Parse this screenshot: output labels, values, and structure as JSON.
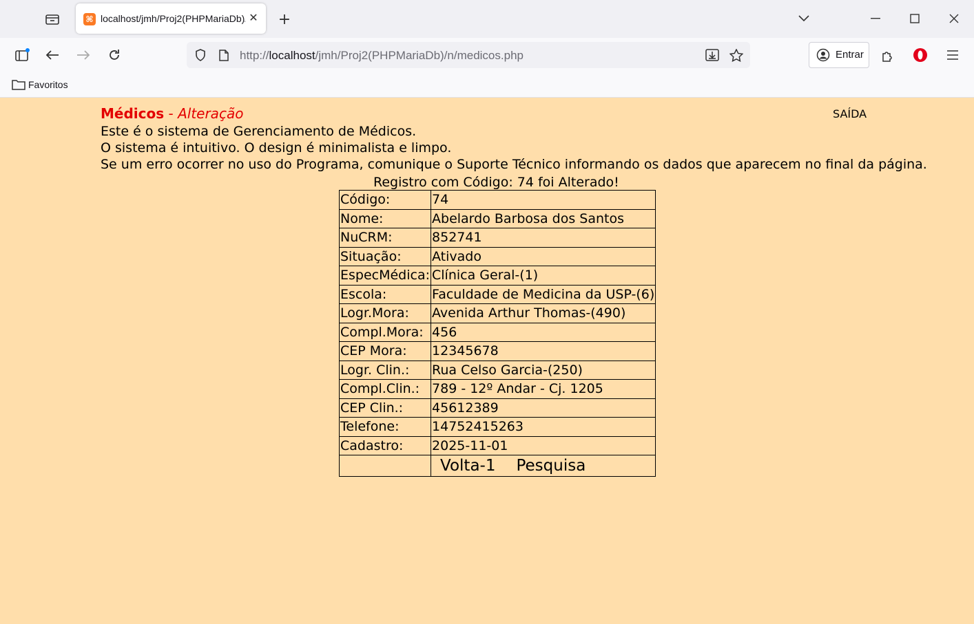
{
  "browser": {
    "tab_title": "localhost/jmh/Proj2(PHPMariaDb)/n/medicos.php",
    "url_host": "localhost",
    "url_prefix": "http://",
    "url_path": "/jmh/Proj2(PHPMariaDb)/n/medicos.php",
    "signin_label": "Entrar",
    "bookmark_folder": "Favoritos"
  },
  "page": {
    "title_main": "Médicos",
    "title_sep": " - ",
    "title_sub": "Alteração",
    "exit_link": "SAÍDA",
    "intro": [
      "Este é o sistema de Gerenciamento de Médicos.",
      "O sistema é intuitivo. O design é minimalista e limpo.",
      "Se um erro ocorrer no uso do Programa, comunique o Suporte Técnico informando os dados que aparecem no final da página."
    ],
    "message": "Registro com Código: 74 foi Alterado!",
    "fields": [
      {
        "label": "Código:",
        "value": "74"
      },
      {
        "label": "Nome:",
        "value": "Abelardo Barbosa dos Santos"
      },
      {
        "label": "NuCRM:",
        "value": "852741"
      },
      {
        "label": "Situação:",
        "value": "Ativado"
      },
      {
        "label": "EspecMédica:",
        "value": "Clínica Geral-(1)"
      },
      {
        "label": "Escola:",
        "value": "Faculdade de Medicina da USP-(6)"
      },
      {
        "label": "Logr.Mora:",
        "value": "Avenida Arthur Thomas-(490)"
      },
      {
        "label": "Compl.Mora:",
        "value": "456"
      },
      {
        "label": "CEP Mora:",
        "value": "12345678"
      },
      {
        "label": "Logr. Clin.:",
        "value": "Rua Celso Garcia-(250)"
      },
      {
        "label": "Compl.Clin.:",
        "value": "789 - 12º Andar - Cj. 1205"
      },
      {
        "label": "CEP Clin.:",
        "value": "45612389"
      },
      {
        "label": "Telefone:",
        "value": "14752415263"
      },
      {
        "label": "Cadastro:",
        "value": "2025-11-01"
      }
    ],
    "back_button": "Volta-1",
    "search_button": "Pesquisa"
  }
}
